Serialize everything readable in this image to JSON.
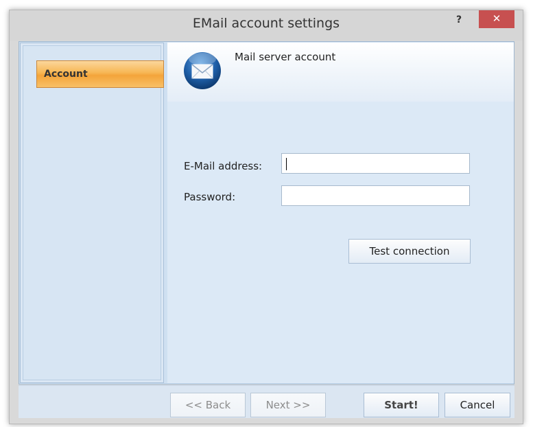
{
  "window": {
    "title": "EMail account settings",
    "help_label": "?",
    "close_label": "✕"
  },
  "sidebar": {
    "items": [
      {
        "label": "Account",
        "selected": true
      }
    ]
  },
  "header": {
    "title": "Mail server account",
    "icon": "envelope-icon"
  },
  "form": {
    "email_label": "E-Mail address:",
    "email_value": "",
    "password_label": "Password:",
    "password_value": "",
    "test_button": "Test connection"
  },
  "footer": {
    "back_label": "<< Back",
    "next_label": "Next >>",
    "start_label": "Start!",
    "cancel_label": "Cancel"
  },
  "colors": {
    "selected_nav": "#f7b653",
    "close_button": "#c75050",
    "panel_bg": "#dce9f6"
  }
}
